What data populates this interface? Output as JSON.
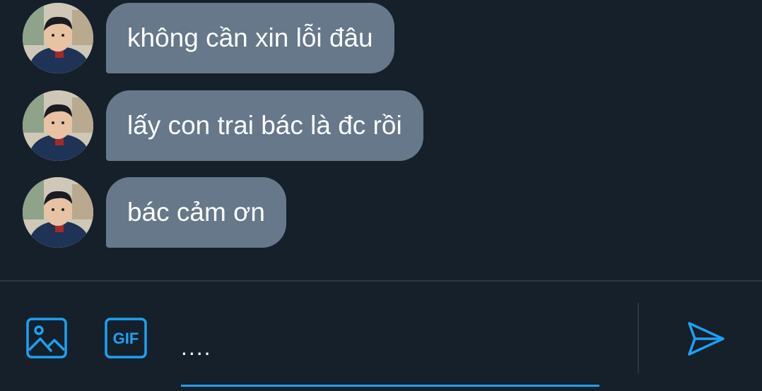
{
  "messages": [
    {
      "text": "không cần xin lỗi đâu",
      "avatar": "user-avatar"
    },
    {
      "text": "lấy con trai bác là đc rồi",
      "avatar": "user-avatar"
    },
    {
      "text": "bác cảm ơn",
      "avatar": "user-avatar"
    }
  ],
  "composer": {
    "image_icon": "image-icon",
    "gif_label": "GIF",
    "input_value": "....",
    "send_icon": "send-icon"
  },
  "colors": {
    "background": "#15202b",
    "bubble": "#66788a",
    "accent": "#1da1f2",
    "divider": "#2b3640"
  }
}
